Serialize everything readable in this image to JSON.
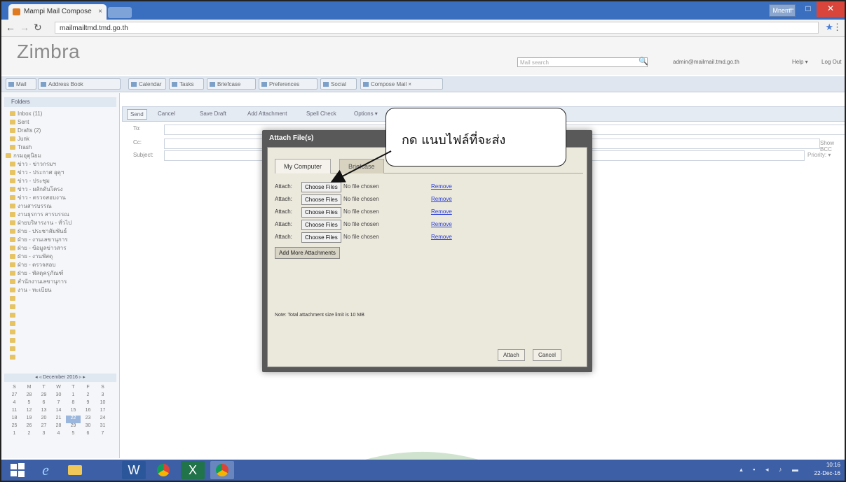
{
  "browser": {
    "tab_title": "Mampi Mail Compose",
    "tab_close_glyph": "×",
    "profile_label": "Mnemi",
    "minimize_glyph": "–",
    "maximize_glyph": "□",
    "close_glyph": "✕",
    "back_glyph": "←",
    "forward_glyph": "→",
    "reload_glyph": "↻",
    "url": "mailmailtmd.tmd.go.th",
    "star_glyph": "★",
    "menu_glyph": "⋮"
  },
  "zimbra": {
    "logo": "Zimbra",
    "search_placeholder": "Mail search",
    "search_glyph": "🔍",
    "user": "admin@mailmail.tmd.go.th",
    "help": "Help ▾",
    "logout": "Log Out"
  },
  "apptabs": [
    "Mail",
    "Address Book",
    "Calendar",
    "Tasks",
    "Briefcase",
    "Preferences",
    "Social",
    "Compose Mail ×"
  ],
  "folders": {
    "header": "Folders",
    "items": [
      "Inbox (11)",
      "Sent",
      "Drafts (2)",
      "Junk",
      "Trash",
      "กรมอุตุนิยม",
      "ข่าว - ข่าวกรมฯ",
      "ข่าว - ประกาศ อุตุฯ",
      "ข่าว - ประชุม",
      "ข่าว - ผลักดันโครง",
      "ข่าว - ตรวจสอบงาน",
      "งานสารบรรณ",
      "งานธุรการ สารบรรณ",
      "ฝ่ายบริหารงาน - ทั่วไป",
      "ฝ่าย - ประชาสัมพันธ์",
      "ฝ่าย - งานเลขานุการ",
      "ฝ่าย - ข้อมูลข่าวสาร",
      "ฝ่าย - งานพัสดุ",
      "ฝ่าย - ตรวจสอบ",
      "ฝ่าย - พัสดุครุภัณฑ์",
      "สำนักงานเลขานุการ",
      "งาน - ทะเบียน",
      "",
      "",
      "",
      "",
      "",
      "",
      "",
      ""
    ]
  },
  "minical": {
    "month": "◂ ◃   December 2016   ▹ ▸",
    "days": [
      "S",
      "M",
      "T",
      "W",
      "T",
      "F",
      "S",
      "27",
      "28",
      "29",
      "30",
      "1",
      "2",
      "3",
      "4",
      "5",
      "6",
      "7",
      "8",
      "9",
      "10",
      "11",
      "12",
      "13",
      "14",
      "15",
      "16",
      "17",
      "18",
      "19",
      "20",
      "21",
      "22",
      "23",
      "24",
      "25",
      "26",
      "27",
      "28",
      "29",
      "30",
      "31",
      "1",
      "2",
      "3",
      "4",
      "5",
      "6",
      "7"
    ],
    "today": "22"
  },
  "compose": {
    "toolbar": [
      "Send",
      "Cancel",
      "Save Draft",
      "Add Attachment",
      "Spell Check",
      "Options ▾"
    ],
    "to_label": "To:",
    "cc_label": "Cc:",
    "show_bcc": "Show BCC",
    "subject_label": "Subject:",
    "subject_value": "",
    "priority": "Priority: ▾",
    "attach_hint": ""
  },
  "dialog": {
    "title": "Attach File(s)",
    "tabs": [
      "My Computer",
      "Briefcase"
    ],
    "rows": [
      {
        "label": "Attach:",
        "button": "Choose Files",
        "status": "No file chosen",
        "remove": "Remove"
      },
      {
        "label": "Attach:",
        "button": "Choose Files",
        "status": "No file chosen",
        "remove": "Remove"
      },
      {
        "label": "Attach:",
        "button": "Choose Files",
        "status": "No file chosen",
        "remove": "Remove"
      },
      {
        "label": "Attach:",
        "button": "Choose Files",
        "status": "No file chosen",
        "remove": "Remove"
      },
      {
        "label": "Attach:",
        "button": "Choose Files",
        "status": "No file chosen",
        "remove": "Remove"
      }
    ],
    "add_more": "Add More Attachments",
    "note": "Note: Total attachment size limit is 10 MB",
    "attach_btn": "Attach",
    "cancel_btn": "Cancel"
  },
  "annotation": {
    "callout": "กด แนบไฟล์ที่จะส่ง"
  },
  "taskbar": {
    "ie_glyph": "e",
    "word_glyph": "W",
    "excel_glyph": "X",
    "tray": "▴ ▪ ◂ ♪ ▬",
    "time": "10:16",
    "date": "22-Dec-16"
  }
}
